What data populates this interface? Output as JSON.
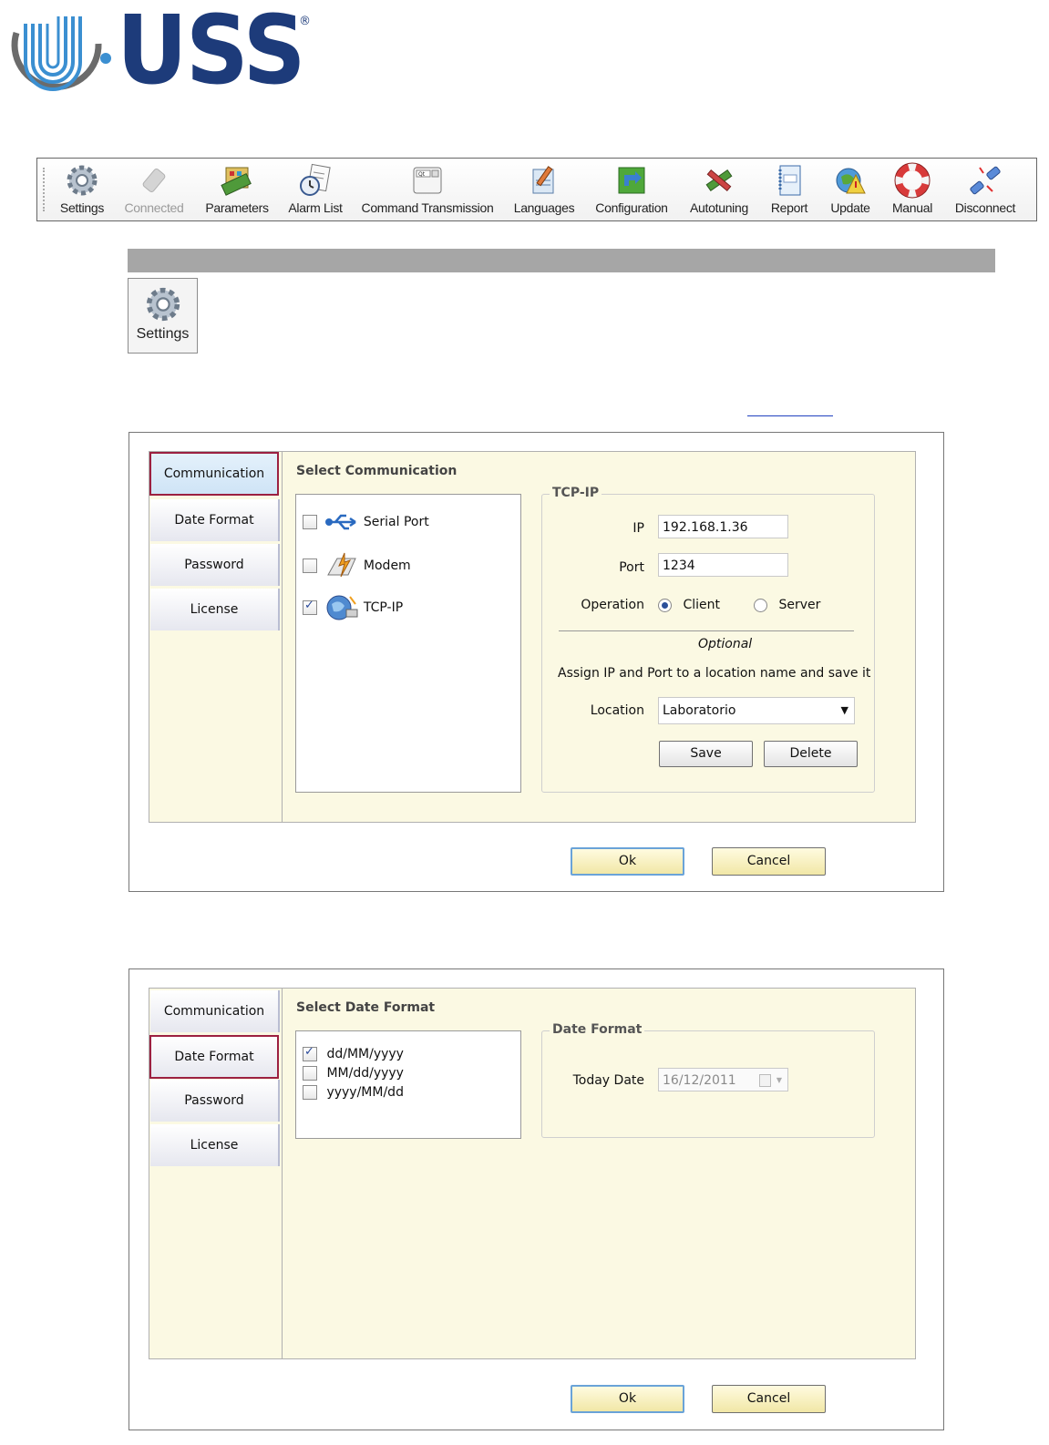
{
  "logo": {
    "text": "USS",
    "registered": "®"
  },
  "toolbar": {
    "items": [
      {
        "label": "Settings",
        "icon": "gear-icon",
        "enabled": true
      },
      {
        "label": "Connected",
        "icon": "plug-icon",
        "enabled": false
      },
      {
        "label": "Parameters",
        "icon": "circuit-board-icon",
        "enabled": true
      },
      {
        "label": "Alarm List",
        "icon": "alarm-clock-icon",
        "enabled": true
      },
      {
        "label": "Command Transmission",
        "icon": "command-window-icon",
        "enabled": true
      },
      {
        "label": "Languages",
        "icon": "pencil-note-icon",
        "enabled": true
      },
      {
        "label": "Configuration",
        "icon": "refresh-arrows-icon",
        "enabled": true
      },
      {
        "label": "Autotuning",
        "icon": "tools-icon",
        "enabled": true
      },
      {
        "label": "Report",
        "icon": "notebook-icon",
        "enabled": true
      },
      {
        "label": "Update",
        "icon": "globe-warning-icon",
        "enabled": true
      },
      {
        "label": "Manual",
        "icon": "lifebuoy-icon",
        "enabled": true
      },
      {
        "label": "Disconnect",
        "icon": "unplug-icon",
        "enabled": true
      }
    ]
  },
  "settings_tile": {
    "label": "Settings",
    "icon": "gear-icon"
  },
  "dialog1": {
    "tabs": [
      "Communication",
      "Date Format",
      "Password",
      "License"
    ],
    "selected_tab": "Communication",
    "section_title": "Select Communication",
    "options": [
      {
        "label": "Serial Port",
        "checked": false,
        "icon": "usb-icon"
      },
      {
        "label": "Modem",
        "checked": false,
        "icon": "modem-icon"
      },
      {
        "label": "TCP-IP",
        "checked": true,
        "icon": "network-globe-icon"
      }
    ],
    "tcp": {
      "title": "TCP-IP",
      "ip_label": "IP",
      "ip_value": "192.168.1.36",
      "port_label": "Port",
      "port_value": "1234",
      "operation_label": "Operation",
      "client_label": "Client",
      "server_label": "Server",
      "operation_value": "Client",
      "optional_label": "Optional",
      "assign_text": "Assign IP and Port to a location name and save it",
      "location_label": "Location",
      "location_value": "Laboratorio",
      "save_label": "Save",
      "delete_label": "Delete"
    },
    "ok_label": "Ok",
    "cancel_label": "Cancel"
  },
  "dialog2": {
    "tabs": [
      "Communication",
      "Date Format",
      "Password",
      "License"
    ],
    "selected_tab": "Date Format",
    "section_title": "Select Date Format",
    "formats": [
      {
        "label": "dd/MM/yyyy",
        "checked": true
      },
      {
        "label": "MM/dd/yyyy",
        "checked": false
      },
      {
        "label": "yyyy/MM/dd",
        "checked": false
      }
    ],
    "group_title": "Date Format",
    "today_label": "Today Date",
    "today_value": "16/12/2011",
    "ok_label": "Ok",
    "cancel_label": "Cancel"
  },
  "colors": {
    "brand": "#1d3b7a",
    "panel": "#fbf9e3",
    "selected_border": "#9c2040"
  }
}
